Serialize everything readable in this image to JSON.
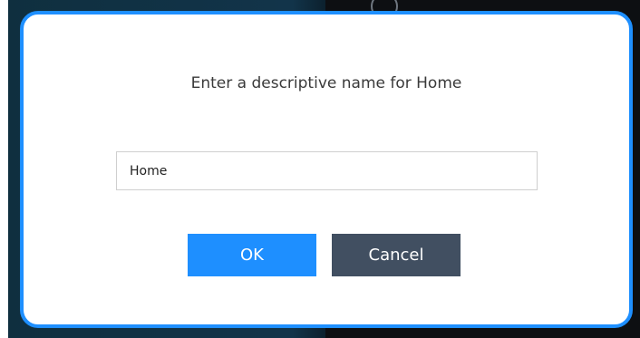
{
  "dialog": {
    "prompt": "Enter a descriptive name for Home",
    "name_field": {
      "value": "Home",
      "placeholder": ""
    },
    "ok_label": "OK",
    "cancel_label": "Cancel"
  },
  "colors": {
    "accent": "#1e8fff",
    "cancel_button": "#414f61",
    "dialog_background": "#ffffff",
    "prompt_text": "#3a3a3a"
  }
}
